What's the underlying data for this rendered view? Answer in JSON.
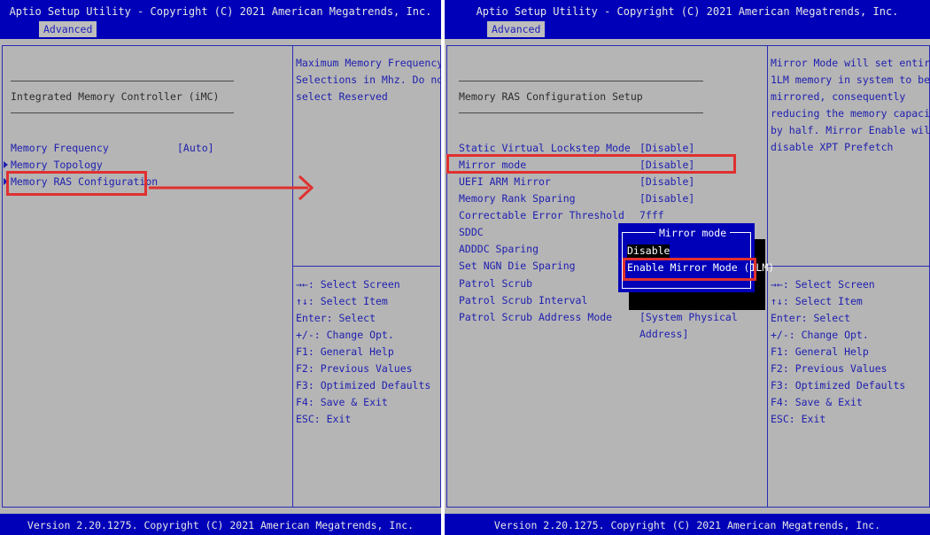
{
  "title": "Aptio Setup Utility - Copyright (C) 2021 American Megatrends, Inc.",
  "footer": "Version 2.20.1275. Copyright (C) 2021 American Megatrends, Inc.",
  "tab": "Advanced",
  "left": {
    "section": "Integrated Memory Controller (iMC)",
    "items": [
      {
        "label": "Memory Frequency",
        "value": "[Auto]"
      },
      {
        "label": "Memory Topology"
      },
      {
        "label": "Memory RAS Configuration"
      }
    ],
    "help": [
      "Maximum Memory Frequency",
      "Selections in Mhz. Do not",
      "select Reserved"
    ]
  },
  "right": {
    "section": "Memory RAS Configuration Setup",
    "items": [
      {
        "label": "Static Virtual Lockstep Mode",
        "value": "[Disable]"
      },
      {
        "label": "Mirror mode",
        "value": "[Disable]"
      },
      {
        "label": "UEFI ARM Mirror",
        "value": "[Disable]"
      },
      {
        "label": "Memory Rank Sparing",
        "value": "[Disable]"
      },
      {
        "label": "Correctable Error Threshold",
        "value": "7fff"
      },
      {
        "label": "SDDC"
      },
      {
        "label": "ADDDC Sparing"
      },
      {
        "label": "Set NGN Die Sparing"
      },
      {
        "label": "Patrol Scrub"
      },
      {
        "label": "Patrol Scrub Interval"
      },
      {
        "label": "Patrol Scrub Address Mode",
        "value": "[System Physical",
        "value2": "Address]"
      }
    ],
    "help": [
      "Mirror Mode will set entire",
      "1LM memory in system to be",
      "mirrored, consequently",
      "reducing the memory capacity",
      "by half. Mirror Enable will",
      "disable XPT Prefetch"
    ]
  },
  "popup": {
    "title": "Mirror mode",
    "options": [
      "Disable",
      "Enable Mirror Mode (1LM)"
    ]
  },
  "keys": [
    "→←: Select Screen",
    "↑↓: Select Item",
    "Enter: Select",
    "+/-: Change Opt.",
    "F1: General Help",
    "F2: Previous Values",
    "F3: Optimized Defaults",
    "F4: Save & Exit",
    "ESC: Exit"
  ],
  "colors": {
    "bar_blue": "#0000b8",
    "panel_grey": "#b5b5b5",
    "annotation_red": "#e03030"
  }
}
